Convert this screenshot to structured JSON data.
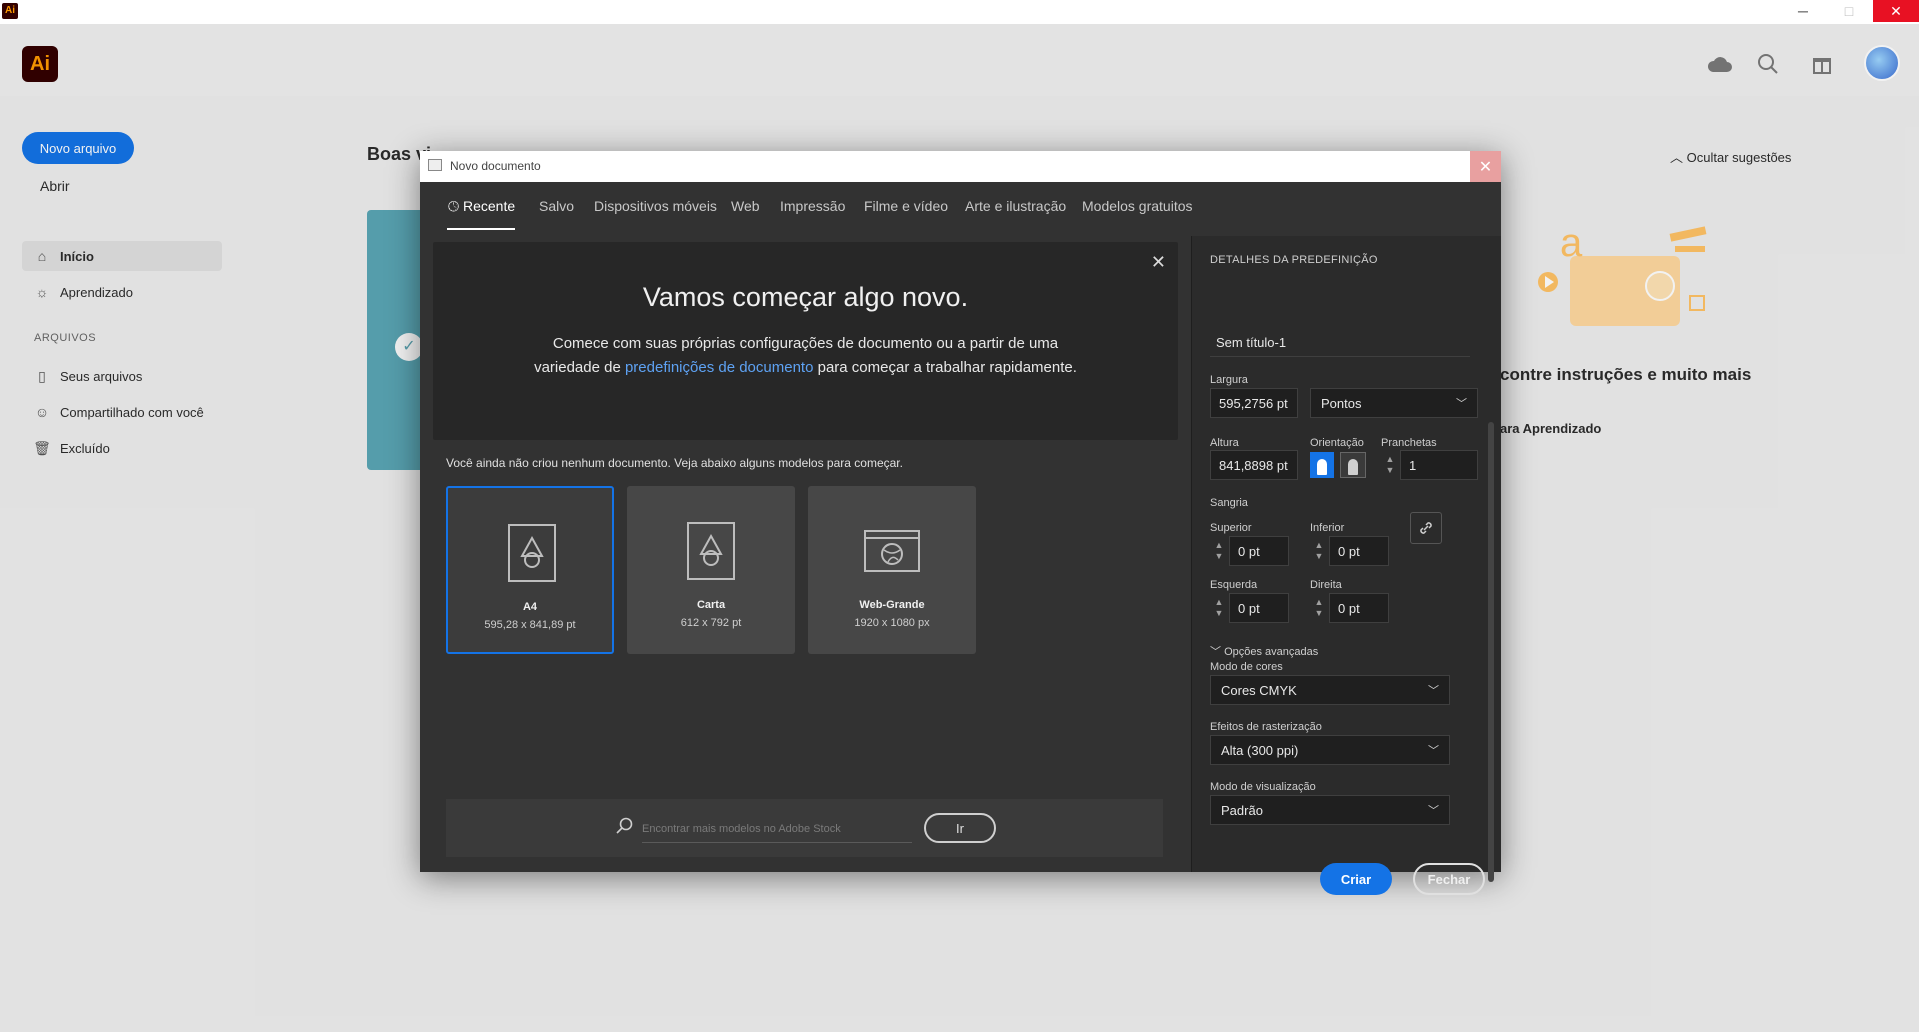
{
  "window": {
    "app_badge": "Ai",
    "minimize": "─",
    "maximize": "□",
    "close": "✕"
  },
  "header": {
    "logo": "Ai",
    "icons": [
      "cloud-icon",
      "search-icon",
      "gift-icon"
    ]
  },
  "sidebar": {
    "new_file": "Novo arquivo",
    "open": "Abrir",
    "items": [
      {
        "label": "Início",
        "icon": "home-icon",
        "active": true
      },
      {
        "label": "Aprendizado",
        "icon": "lightbulb-icon",
        "active": false
      }
    ],
    "files_section": "ARQUIVOS",
    "file_items": [
      {
        "label": "Seus arquivos",
        "icon": "file-icon"
      },
      {
        "label": "Compartilhado com você",
        "icon": "shared-user-icon"
      },
      {
        "label": "Excluído",
        "icon": "trash-icon"
      }
    ]
  },
  "background": {
    "welcome": "Boas vi",
    "hide_suggestions": "Ocultar sugestões",
    "find_instructions": "contre instruções e muito mais",
    "learn_link": "ara Aprendizado"
  },
  "dialog": {
    "title": "Novo documento",
    "tabs": [
      "Recente",
      "Salvo",
      "Dispositivos móveis",
      "Web",
      "Impressão",
      "Filme e vídeo",
      "Arte e ilustração",
      "Modelos gratuitos"
    ],
    "active_tab": "Recente",
    "intro": {
      "title": "Vamos começar algo novo.",
      "text_before": "Comece com suas próprias configurações de documento ou a partir de uma variedade de ",
      "link": "predefinições de documento",
      "text_after": " para começar a trabalhar rapidamente."
    },
    "models_caption": "Você ainda não criou nenhum documento. Veja abaixo alguns modelos para começar.",
    "templates": [
      {
        "name": "A4",
        "size": "595,28 x 841,89 pt",
        "selected": true,
        "icon": "document-shapes-icon"
      },
      {
        "name": "Carta",
        "size": "612 x 792 pt",
        "selected": false,
        "icon": "document-shapes-icon"
      },
      {
        "name": "Web-Grande",
        "size": "1920 x 1080 px",
        "selected": false,
        "icon": "web-globe-icon"
      }
    ],
    "stock": {
      "placeholder": "Encontrar mais modelos no Adobe Stock",
      "go": "Ir"
    },
    "preset": {
      "heading": "DETALHES DA PREDEFINIÇÃO",
      "name": "Sem título-1",
      "width_label": "Largura",
      "width": "595,2756 pt",
      "units": "Pontos",
      "height_label": "Altura",
      "height": "841,8898 pt",
      "orientation_label": "Orientação",
      "artboards_label": "Pranchetas",
      "artboards": "1",
      "bleed_label": "Sangria",
      "top_label": "Superior",
      "top": "0 pt",
      "bottom_label": "Inferior",
      "bottom": "0 pt",
      "left_label": "Esquerda",
      "left": "0 pt",
      "right_label": "Direita",
      "right": "0 pt",
      "advanced": "Opções avançadas",
      "color_mode_label": "Modo de cores",
      "color_mode": "Cores CMYK",
      "raster_label": "Efeitos de rasterização",
      "raster": "Alta (300 ppi)",
      "preview_label": "Modo de visualização",
      "preview": "Padrão",
      "create": "Criar",
      "close": "Fechar"
    }
  },
  "colors": {
    "accent": "#1473e6",
    "dialog_bg": "#323232",
    "panel_bg": "#2b2b2b"
  }
}
